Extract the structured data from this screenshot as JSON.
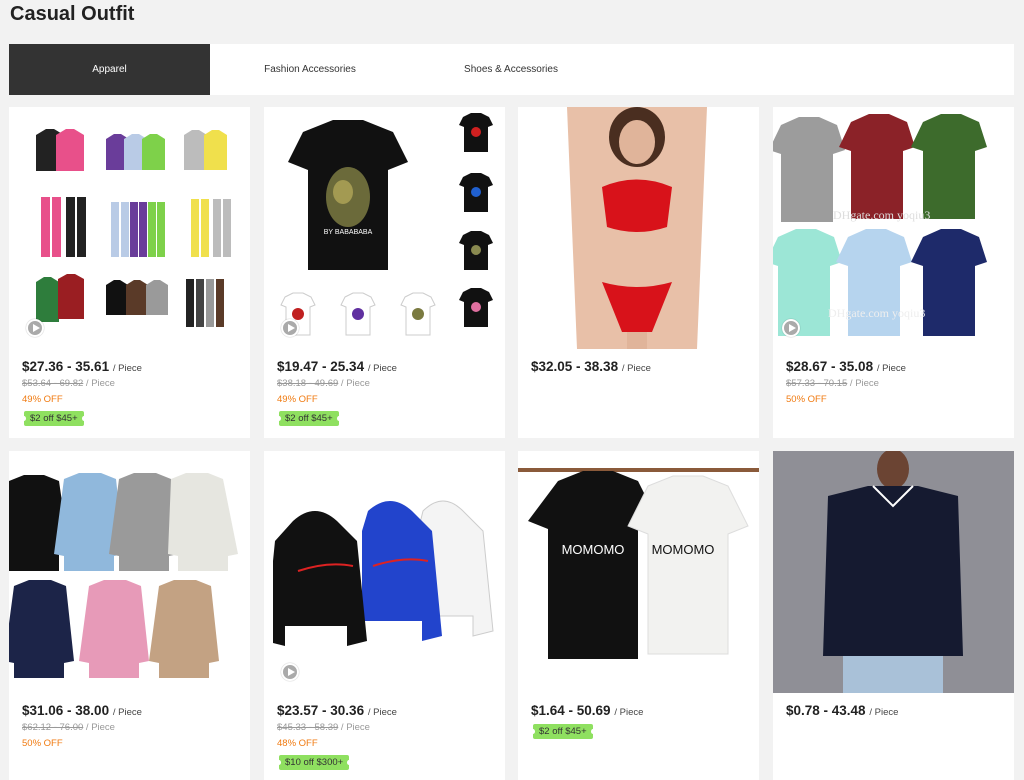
{
  "page": {
    "title": "Casual Outfit"
  },
  "tabs": [
    {
      "label": "Apparel",
      "active": true
    },
    {
      "label": "Fashion Accessories",
      "active": false
    },
    {
      "label": "Shoes & Accessories",
      "active": false
    }
  ],
  "products": [
    {
      "price": "$27.36 - 35.61",
      "unit": "/ Piece",
      "original": "$53.64 - 69.82",
      "original_unit": "/ Piece",
      "discount": "49% OFF",
      "coupon": "$2 off $45+",
      "has_video": true,
      "image": "hoodie-sweatpants-set"
    },
    {
      "price": "$19.47 - 25.34",
      "unit": "/ Piece",
      "original": "$38.18 - 49.69",
      "original_unit": "/ Piece",
      "discount": "49% OFF",
      "coupon": "$2 off $45+",
      "has_video": true,
      "image": "camo-ape-tshirt",
      "image_text": "BY BABABABA"
    },
    {
      "price": "$32.05 - 38.38",
      "unit": "/ Piece",
      "image": "red-lingerie-set"
    },
    {
      "price": "$28.67 - 35.08",
      "unit": "/ Piece",
      "original": "$57.33 - 70.15",
      "original_unit": "/ Piece",
      "discount": "50% OFF",
      "has_video": true,
      "image": "short-sleeve-shirts",
      "watermark_1": "DHgate.com yoqiu3",
      "watermark_2": "DHgate.com yoqiu3"
    },
    {
      "price": "$31.06 - 38.00",
      "unit": "/ Piece",
      "original": "$62.12 - 76.00",
      "original_unit": "/ Piece",
      "discount": "50% OFF",
      "image": "cable-knit-sweaters"
    },
    {
      "price": "$23.57 - 30.36",
      "unit": "/ Piece",
      "original": "$45.33 - 58.39",
      "original_unit": "/ Piece",
      "discount": "48% OFF",
      "coupon": "$10 off $300+",
      "has_video": true,
      "image": "wave-logo-hoodies"
    },
    {
      "price": "$1.64 - 50.69",
      "unit": "/ Piece",
      "coupon": "$2 off $45+",
      "image": "momomo-tshirts",
      "image_text": "MOMOMO"
    },
    {
      "price": "$0.78 - 43.48",
      "unit": "/ Piece",
      "image": "navy-polo-model"
    }
  ],
  "colors": {
    "tab_active_bg": "#333333",
    "discount": "#f07a10",
    "coupon_bg": "#8fe060"
  }
}
